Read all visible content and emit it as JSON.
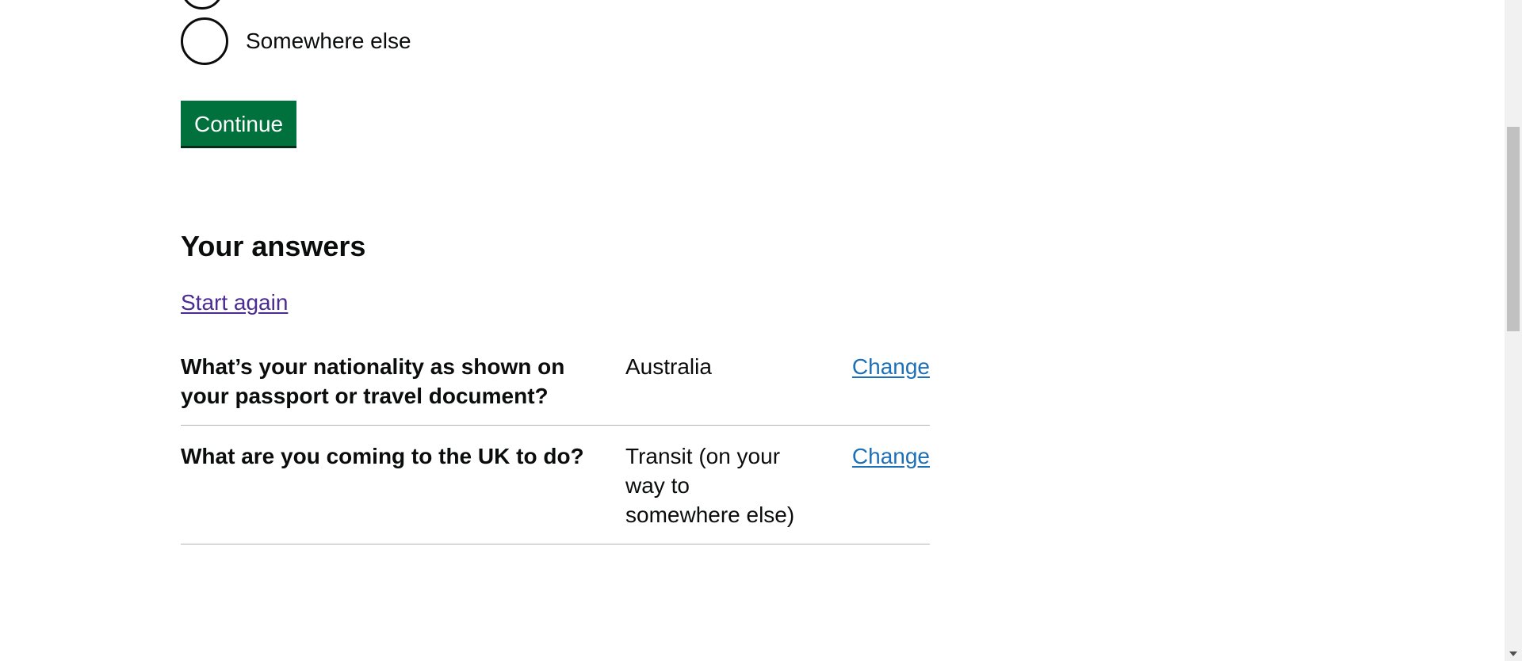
{
  "radios": [
    {
      "label": "Somewhere else",
      "checked": false
    }
  ],
  "continue_label": "Continue",
  "answers": {
    "heading": "Your answers",
    "start_again": "Start again",
    "rows": [
      {
        "question": "What’s your nationality as shown on your passport or travel document?",
        "answer": "Australia",
        "action": "Change"
      },
      {
        "question": "What are you coming to the UK to do?",
        "answer": "Transit (on your way to somewhere else)",
        "action": "Change"
      }
    ]
  },
  "colors": {
    "button": "#00703c",
    "link": "#1d70b8",
    "visited_link": "#4c2c92",
    "text": "#0b0c0c",
    "divider": "#b1b4b6"
  }
}
